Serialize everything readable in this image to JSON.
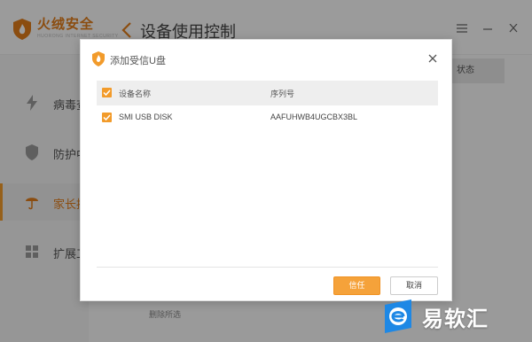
{
  "app": {
    "brand": "火绒安全",
    "brand_sub": "HUORONG INTERNET SECURITY",
    "page_title": "设备使用控制",
    "menu_icon": "menu-icon",
    "minimize_icon": "minimize-icon",
    "close_icon": "close-icon"
  },
  "sidebar": {
    "items": [
      {
        "label": "病毒查杀",
        "icon": "lightning-icon"
      },
      {
        "label": "防护中心",
        "icon": "shield-icon"
      },
      {
        "label": "家长控制",
        "icon": "umbrella-icon"
      },
      {
        "label": "扩展工具",
        "icon": "grid-icon"
      }
    ]
  },
  "main": {
    "status_header": "状态",
    "remove_selected": "删除所选"
  },
  "dialog": {
    "title": "添加受信U盘",
    "columns": {
      "name": "设备名称",
      "serial": "序列号"
    },
    "rows": [
      {
        "name": "SMI USB DISK",
        "serial": "AAFUHWB4UGCBX3BL",
        "checked": true
      }
    ],
    "trust_button": "信任",
    "cancel_button": "取消"
  },
  "watermark": {
    "text": "易软汇"
  },
  "colors": {
    "accent": "#f29b2b",
    "brand": "#e07c1a"
  }
}
